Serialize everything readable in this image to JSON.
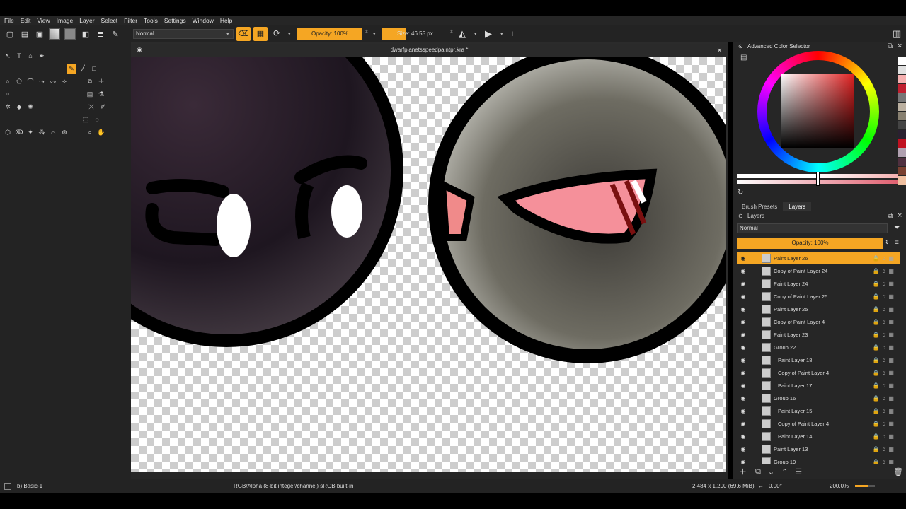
{
  "menu": [
    "File",
    "Edit",
    "View",
    "Image",
    "Layer",
    "Select",
    "Filter",
    "Tools",
    "Settings",
    "Window",
    "Help"
  ],
  "toolbar": {
    "blend_mode": "Normal",
    "opacity": "Opacity: 100%",
    "size": "Size: 46.55 px"
  },
  "document": {
    "title": "dwarfplanetsspeedpaintpr.kra *",
    "close": "×"
  },
  "right_panel": {
    "color_selector_title": "Advanced Color Selector",
    "tabs": [
      "Brush Presets",
      "Layers"
    ],
    "layers_title": "Layers",
    "blend_mode": "Normal",
    "opacity": "Opacity:  100%"
  },
  "layers": [
    {
      "name": "Paint Layer 26",
      "indent": 0,
      "active": true
    },
    {
      "name": "Copy of Paint Layer 24",
      "indent": 0
    },
    {
      "name": "Paint Layer 24",
      "indent": 0
    },
    {
      "name": "Copy of Paint Layer 25",
      "indent": 0
    },
    {
      "name": "Paint Layer 25",
      "indent": 0
    },
    {
      "name": "Copy of Paint Layer 4",
      "indent": 0
    },
    {
      "name": "Paint Layer 23",
      "indent": 0
    },
    {
      "name": "Group 22",
      "indent": 0
    },
    {
      "name": "Paint Layer 18",
      "indent": 1
    },
    {
      "name": "Copy of Paint Layer 4",
      "indent": 1
    },
    {
      "name": "Paint Layer 17",
      "indent": 1
    },
    {
      "name": "Group 16",
      "indent": 0
    },
    {
      "name": "Paint Layer 15",
      "indent": 1
    },
    {
      "name": "Copy of Paint Layer 4",
      "indent": 1
    },
    {
      "name": "Paint Layer 14",
      "indent": 1
    },
    {
      "name": "Paint Layer 13",
      "indent": 0
    },
    {
      "name": "Group 19",
      "indent": 0
    }
  ],
  "status": {
    "brush": "b) Basic-1",
    "color_info": "RGB/Alpha (8-bit integer/channel)  sRGB built-in",
    "dimensions": "2,484 x 1,200 (69.6 MiB)",
    "rotation": "0.00°",
    "zoom": "200.0%"
  },
  "colors": {
    "accent": "#f5a623",
    "panel": "#262626"
  }
}
